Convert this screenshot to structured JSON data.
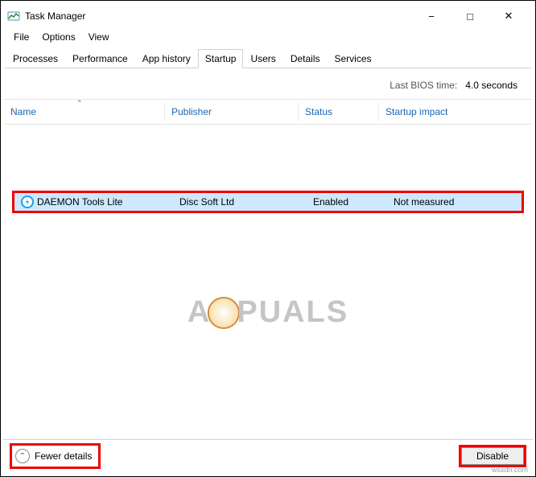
{
  "window": {
    "title": "Task Manager"
  },
  "menu": {
    "file": "File",
    "options": "Options",
    "view": "View"
  },
  "tabs": {
    "processes": "Processes",
    "performance": "Performance",
    "app_history": "App history",
    "startup": "Startup",
    "users": "Users",
    "details": "Details",
    "services": "Services"
  },
  "bios": {
    "label": "Last BIOS time:",
    "value": "4.0 seconds"
  },
  "columns": {
    "name": "Name",
    "publisher": "Publisher",
    "status": "Status",
    "impact": "Startup impact"
  },
  "rows": [
    {
      "name": "DAEMON Tools Lite",
      "publisher": "Disc Soft Ltd",
      "status": "Enabled",
      "impact": "Not measured"
    }
  ],
  "footer": {
    "fewer": "Fewer details",
    "disable": "Disable"
  },
  "watermark": {
    "left": "A",
    "right": "PUALS"
  },
  "credit": "wsxdn.com"
}
